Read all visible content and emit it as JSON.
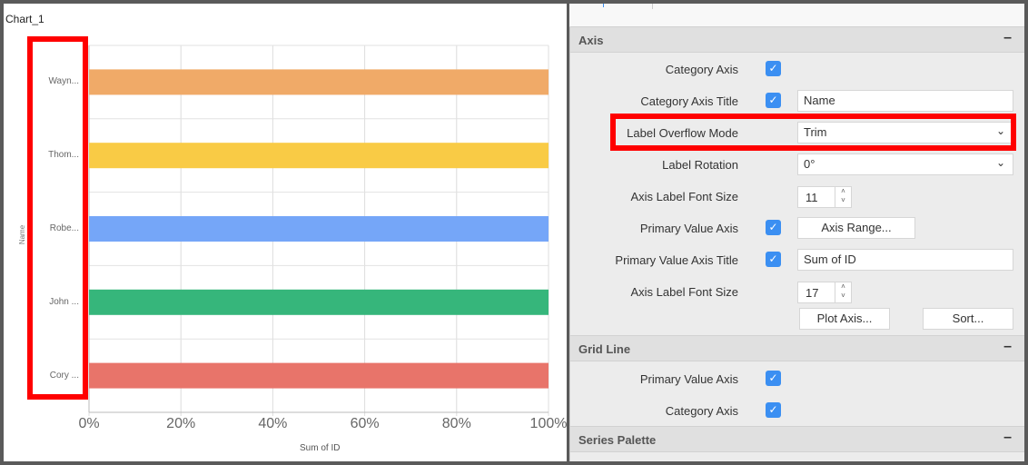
{
  "chart_title": "Chart_1",
  "chart_data": {
    "type": "bar",
    "orientation": "horizontal",
    "stacking": "100%",
    "categories": [
      "Wayn...",
      "Thom...",
      "Robe...",
      "John ...",
      "Cory ..."
    ],
    "values": [
      100,
      100,
      100,
      100,
      100
    ],
    "colors": [
      "#f0aa68",
      "#f9cb45",
      "#75a6f8",
      "#36b67b",
      "#e8746a"
    ],
    "xlabel": "Sum of ID",
    "ylabel": "Name",
    "xlim": [
      0,
      100
    ],
    "x_ticks": [
      "0%",
      "20%",
      "40%",
      "60%",
      "80%",
      "100%"
    ],
    "grid": true
  },
  "panel": {
    "axis_section": {
      "title": "Axis",
      "collapse": "–",
      "category_axis": {
        "label": "Category Axis",
        "checked": true
      },
      "category_axis_title": {
        "label": "Category Axis Title",
        "checked": true,
        "value": "Name"
      },
      "label_overflow_mode": {
        "label": "Label Overflow Mode",
        "value": "Trim"
      },
      "label_rotation": {
        "label": "Label Rotation",
        "value": "0°"
      },
      "cat_font_size": {
        "label": "Axis Label Font Size",
        "value": "11"
      },
      "primary_value_axis": {
        "label": "Primary Value Axis",
        "checked": true,
        "button": "Axis Range..."
      },
      "primary_value_axis_title": {
        "label": "Primary Value Axis Title",
        "checked": true,
        "value": "Sum of ID"
      },
      "val_font_size": {
        "label": "Axis Label Font Size",
        "value": "17"
      },
      "plot_axis_button": "Plot Axis...",
      "sort_button": "Sort..."
    },
    "grid_section": {
      "title": "Grid Line",
      "collapse": "–",
      "primary_value_axis": {
        "label": "Primary Value Axis",
        "checked": true
      },
      "category_axis": {
        "label": "Category Axis",
        "checked": true
      }
    },
    "palette_section": {
      "title": "Series Palette",
      "collapse": "–"
    }
  },
  "icons": {
    "check": "✓",
    "chevron": "⌄",
    "up": "˄",
    "down": "˅"
  }
}
